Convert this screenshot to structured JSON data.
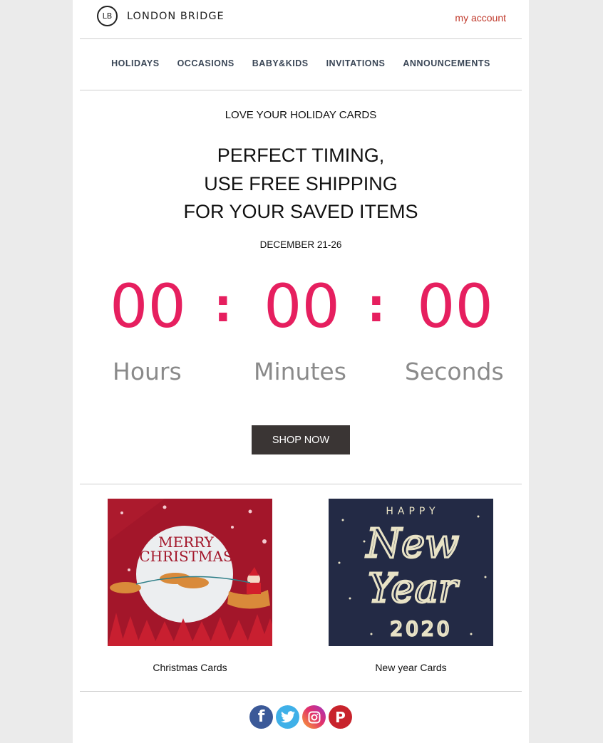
{
  "brand": {
    "logo_mark": "LB",
    "name": "LONDON BRIDGE"
  },
  "header": {
    "account_link": "my account"
  },
  "nav": {
    "items": [
      "HOLIDAYS",
      "OCCASIONS",
      "BABY&KIDS",
      "INVITATIONS",
      "ANNOUNCEMENTS"
    ]
  },
  "hero": {
    "eyebrow": "LOVE YOUR HOLIDAY CARDS",
    "headline_lines": [
      "PERFECT TIMING,",
      "USE FREE SHIPPING",
      "FOR YOUR SAVED ITEMS"
    ],
    "dates": "DECEMBER 21-26"
  },
  "countdown": {
    "hours": "00",
    "minutes": "00",
    "seconds": "00",
    "separator": ":",
    "labels": {
      "hours": "Hours",
      "minutes": "Minutes",
      "seconds": "Seconds"
    },
    "color": "#e61f5f"
  },
  "cta": {
    "label": "SHOP NOW"
  },
  "cards": [
    {
      "caption": "Christmas Cards",
      "image_title_lines": [
        "MERRY",
        "CHRISTMAS"
      ]
    },
    {
      "caption": "New year Cards",
      "image_title_lines": [
        "HAPPY",
        "New",
        "Year",
        "2020"
      ]
    }
  ],
  "social": [
    {
      "name": "facebook",
      "glyph": "f",
      "color": "#3b5998"
    },
    {
      "name": "twitter",
      "glyph": "t",
      "color": "#3fb0e8"
    },
    {
      "name": "instagram",
      "glyph": "◎",
      "color": "#d6286f"
    },
    {
      "name": "pinterest",
      "glyph": "P",
      "color": "#c8232c"
    }
  ],
  "colors": {
    "accent": "#e61f5f",
    "link": "#c0392b",
    "button": "#3a3534",
    "nav": "#3a4656"
  }
}
